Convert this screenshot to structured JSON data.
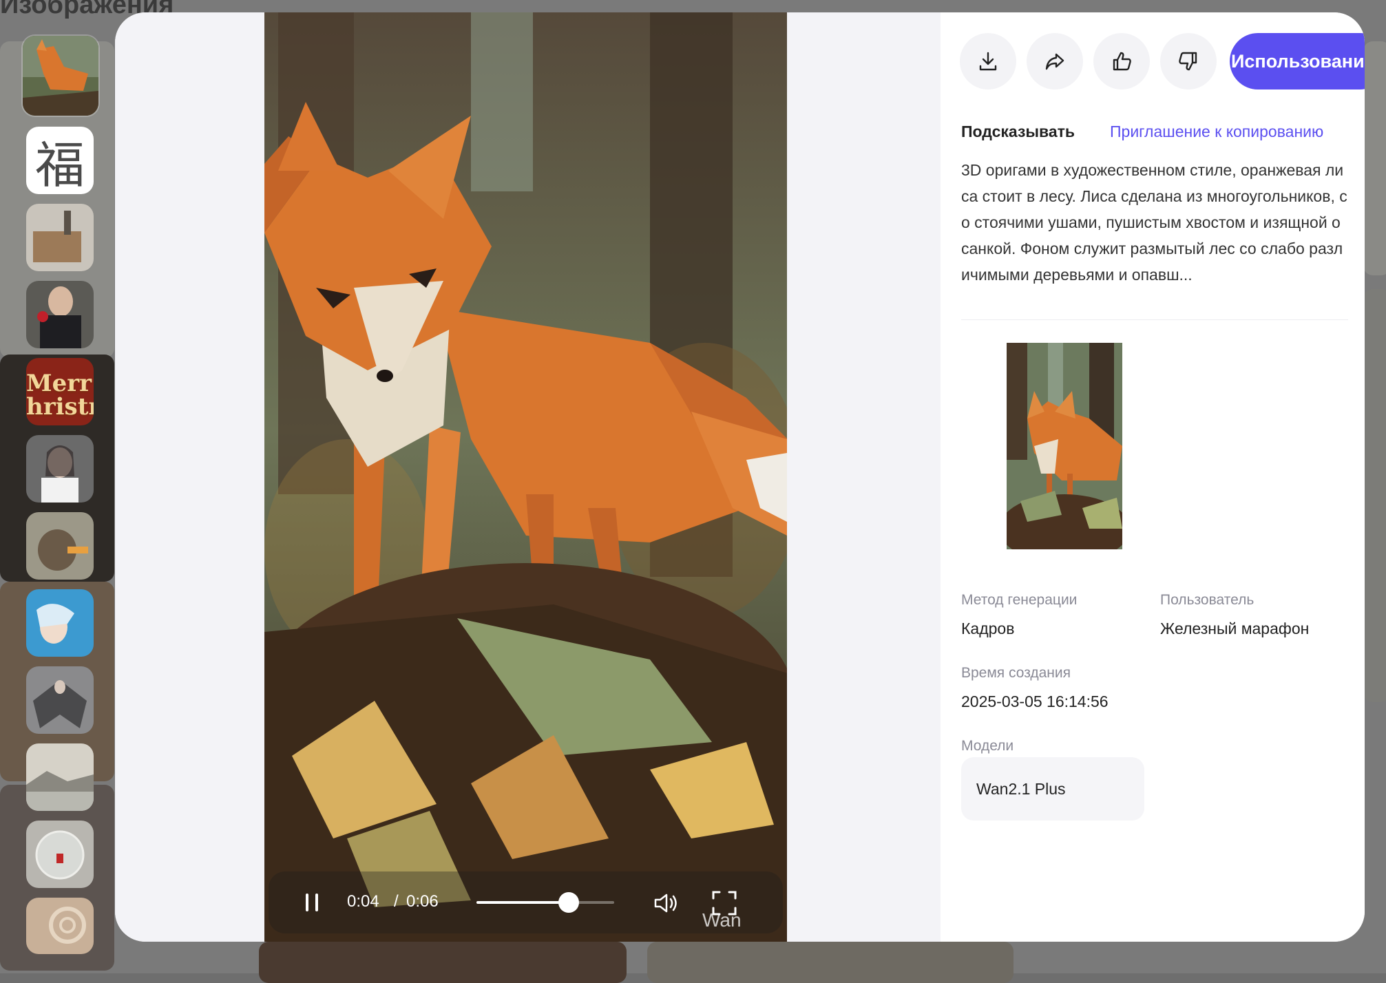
{
  "background": {
    "section_title": "Изображения"
  },
  "thumbnails": [
    {
      "name": "thumb-origami-fox",
      "active": true
    },
    {
      "name": "thumb-fu-character",
      "glyph": "福"
    },
    {
      "name": "thumb-miniature-scene"
    },
    {
      "name": "thumb-man-with-rose"
    },
    {
      "name": "thumb-merry-christmas",
      "text": "Merr\nhristn"
    },
    {
      "name": "thumb-woman-portrait"
    },
    {
      "name": "thumb-groundhog"
    },
    {
      "name": "thumb-underwater-girl"
    },
    {
      "name": "thumb-winged-figure"
    },
    {
      "name": "thumb-lake-landscape"
    },
    {
      "name": "thumb-glass-sphere"
    },
    {
      "name": "thumb-swirl"
    }
  ],
  "player": {
    "current_time": "0:04",
    "separator": "/",
    "duration": "0:06",
    "progress": 0.67,
    "watermark": "Wan",
    "icons": {
      "pause": "pause-icon",
      "volume": "volume-icon",
      "fullscreen": "fullscreen-icon"
    }
  },
  "actions": {
    "icons": [
      "download-icon",
      "share-icon",
      "thumbs-up-icon",
      "thumbs-down-icon"
    ],
    "use_label": "Использовани"
  },
  "prompt_section": {
    "title": "Подсказывать",
    "copy_link": "Приглашение к копированию",
    "text": "3D оригами в художественном стиле, оранжевая лиса стоит в лесу. Лиса сделана из многоугольников, со стоячими ушами, пушистым хвостом и изящной осанкой. Фоном служит размытый лес со слабо различимыми деревьями и опавш..."
  },
  "meta": {
    "method_label": "Метод генерации",
    "method_value": "Кадров",
    "user_label": "Пользователь",
    "user_value": "Железный марафон",
    "created_label": "Время создания",
    "created_value": "2025-03-05 16:14:56",
    "models_label": "Модели",
    "model_value": "Wan2.1 Plus"
  },
  "colors": {
    "accent": "#5b4ff0",
    "fox_orange": "#d9762e",
    "panel_bg": "#ffffff",
    "media_bg": "#f3f3f7"
  }
}
